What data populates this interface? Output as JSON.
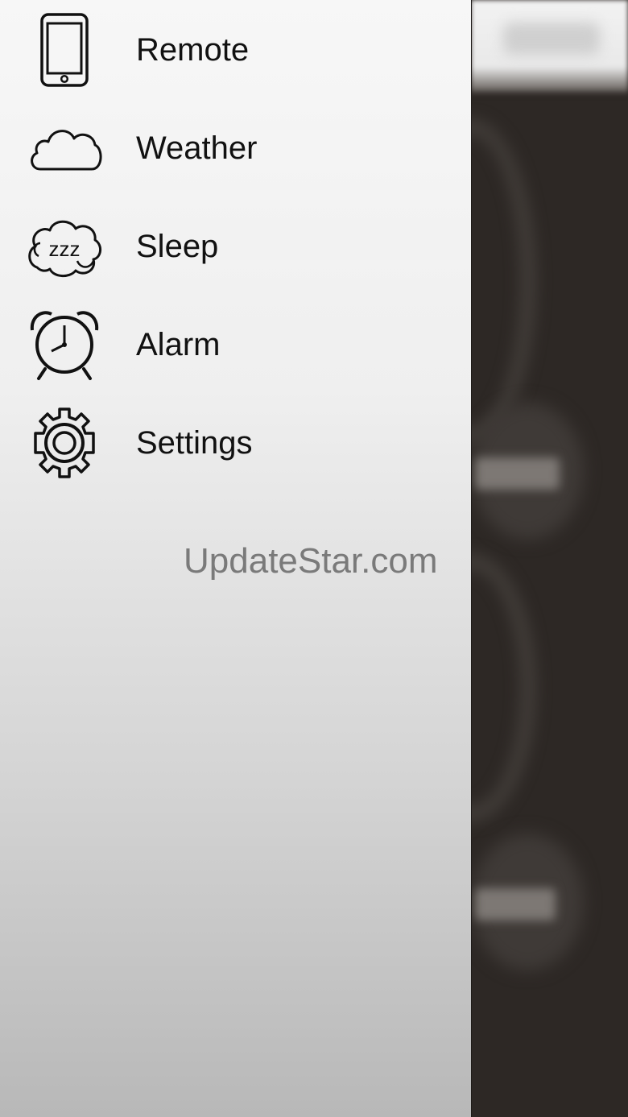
{
  "menu": {
    "items": [
      {
        "label": "Remote",
        "icon": "phone-icon"
      },
      {
        "label": "Weather",
        "icon": "cloud-icon"
      },
      {
        "label": "Sleep",
        "icon": "sleep-zzz-icon"
      },
      {
        "label": "Alarm",
        "icon": "alarm-clock-icon"
      },
      {
        "label": "Settings",
        "icon": "gear-icon"
      }
    ]
  },
  "watermark": "UpdateStar.com",
  "colors": {
    "drawer_top": "#f7f7f7",
    "drawer_bottom": "#b8b8b8",
    "background_app": "#2d2825",
    "menu_text": "#111111",
    "watermark_text": "#7a7a7a"
  }
}
